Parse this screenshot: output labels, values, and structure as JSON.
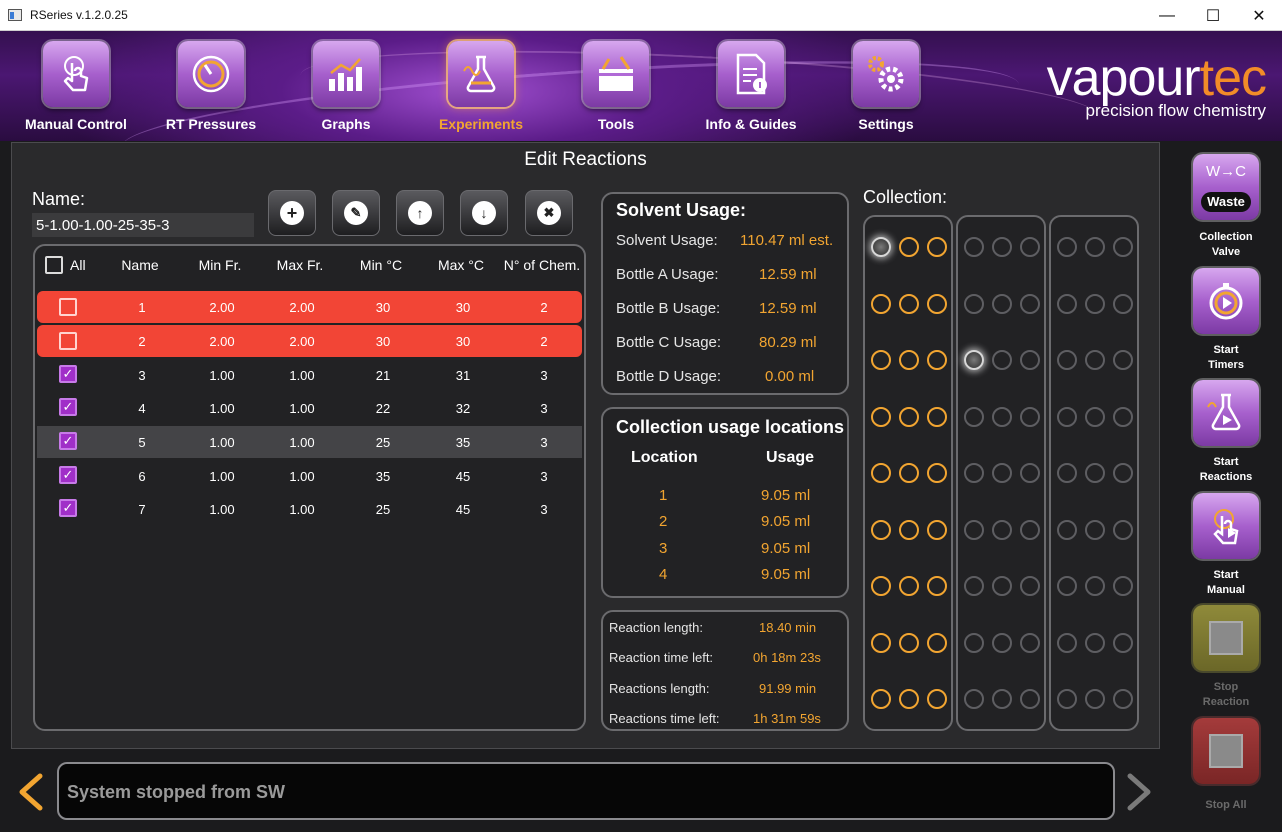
{
  "window": {
    "title": "RSeries v.1.2.0.25",
    "minimize": "—",
    "maximize": "☐",
    "close": "✕"
  },
  "nav": {
    "items": [
      {
        "label": "Manual Control",
        "icon": "hand-touch-icon"
      },
      {
        "label": "RT Pressures",
        "icon": "gauge-icon"
      },
      {
        "label": "Graphs",
        "icon": "bar-chart-icon"
      },
      {
        "label": "Experiments",
        "icon": "flask-icon",
        "active": true
      },
      {
        "label": "Tools",
        "icon": "toolbox-icon"
      },
      {
        "label": "Info & Guides",
        "icon": "document-info-icon"
      },
      {
        "label": "Settings",
        "icon": "gears-icon"
      }
    ]
  },
  "logo": {
    "word_prefix": "vapour",
    "word_suffix": "tec",
    "tagline": "precision flow chemistry"
  },
  "edit": {
    "heading": "Edit Reactions",
    "name_label": "Name:",
    "name_value": "5-1.00-1.00-25-35-3"
  },
  "table": {
    "headers": {
      "all": "All",
      "name": "Name",
      "min_fr": "Min Fr.",
      "max_fr": "Max Fr.",
      "min_c": "Min °C",
      "max_c": "Max °C",
      "chem": "N° of Chem."
    },
    "rows": [
      {
        "name": "1",
        "min_fr": "2.00",
        "max_fr": "2.00",
        "min_c": "30",
        "max_c": "30",
        "chem": "2",
        "checked": false,
        "state": "error"
      },
      {
        "name": "2",
        "min_fr": "2.00",
        "max_fr": "2.00",
        "min_c": "30",
        "max_c": "30",
        "chem": "2",
        "checked": false,
        "state": "error"
      },
      {
        "name": "3",
        "min_fr": "1.00",
        "max_fr": "1.00",
        "min_c": "21",
        "max_c": "31",
        "chem": "3",
        "checked": true,
        "state": "normal"
      },
      {
        "name": "4",
        "min_fr": "1.00",
        "max_fr": "1.00",
        "min_c": "22",
        "max_c": "32",
        "chem": "3",
        "checked": true,
        "state": "normal"
      },
      {
        "name": "5",
        "min_fr": "1.00",
        "max_fr": "1.00",
        "min_c": "25",
        "max_c": "35",
        "chem": "3",
        "checked": true,
        "state": "selected"
      },
      {
        "name": "6",
        "min_fr": "1.00",
        "max_fr": "1.00",
        "min_c": "35",
        "max_c": "45",
        "chem": "3",
        "checked": true,
        "state": "normal"
      },
      {
        "name": "7",
        "min_fr": "1.00",
        "max_fr": "1.00",
        "min_c": "25",
        "max_c": "45",
        "chem": "3",
        "checked": true,
        "state": "normal"
      }
    ]
  },
  "solvent": {
    "title": "Solvent Usage:",
    "rows": [
      {
        "label": "Solvent Usage:",
        "value": "110.47 ml est."
      },
      {
        "label": "Bottle A Usage:",
        "value": "12.59 ml"
      },
      {
        "label": "Bottle B Usage:",
        "value": "12.59 ml"
      },
      {
        "label": "Bottle C Usage:",
        "value": "80.29 ml"
      },
      {
        "label": "Bottle D Usage:",
        "value": "0.00 ml"
      }
    ]
  },
  "collection_usage": {
    "title": "Collection usage locations",
    "col_location": "Location",
    "col_usage": "Usage",
    "rows": [
      {
        "location": "1",
        "usage": "9.05 ml"
      },
      {
        "location": "2",
        "usage": "9.05 ml"
      },
      {
        "location": "3",
        "usage": "9.05 ml"
      },
      {
        "location": "4",
        "usage": "9.05 ml"
      }
    ]
  },
  "timing": {
    "rows": [
      {
        "label": "Reaction length:",
        "value": "18.40 min"
      },
      {
        "label": "Reaction time left:",
        "value": "0h 18m 23s"
      },
      {
        "label": "Reactions length:",
        "value": "91.99 min"
      },
      {
        "label": "Reactions time left:",
        "value": "1h 31m 59s"
      }
    ]
  },
  "collection": {
    "label": "Collection:",
    "racks": [
      {
        "rows": [
          [
            "w",
            "o",
            "o"
          ],
          [
            "o",
            "o",
            "o"
          ],
          [
            "o",
            "o",
            "o"
          ],
          [
            "o",
            "o",
            "o"
          ],
          [
            "o",
            "o",
            "o"
          ],
          [
            "o",
            "o",
            "o"
          ],
          [
            "o",
            "o",
            "o"
          ],
          [
            "o",
            "o",
            "o"
          ],
          [
            "o",
            "o",
            "o"
          ]
        ]
      },
      {
        "rows": [
          [
            "g",
            "g",
            "g"
          ],
          [
            "g",
            "g",
            "g"
          ],
          [
            "w",
            "g",
            "g"
          ],
          [
            "g",
            "g",
            "g"
          ],
          [
            "g",
            "g",
            "g"
          ],
          [
            "g",
            "g",
            "g"
          ],
          [
            "g",
            "g",
            "g"
          ],
          [
            "g",
            "g",
            "g"
          ],
          [
            "g",
            "g",
            "g"
          ]
        ]
      },
      {
        "rows": [
          [
            "g",
            "g",
            "g"
          ],
          [
            "g",
            "g",
            "g"
          ],
          [
            "g",
            "g",
            "g"
          ],
          [
            "g",
            "g",
            "g"
          ],
          [
            "g",
            "g",
            "g"
          ],
          [
            "g",
            "g",
            "g"
          ],
          [
            "g",
            "g",
            "g"
          ],
          [
            "g",
            "g",
            "g"
          ],
          [
            "g",
            "g",
            "g"
          ]
        ]
      }
    ]
  },
  "side": {
    "collection_valve": {
      "top": "W→C",
      "badge": "Waste",
      "label1": "Collection",
      "label2": "Valve"
    },
    "start_timers": {
      "label1": "Start",
      "label2": "Timers"
    },
    "start_reactions": {
      "label1": "Start",
      "label2": "Reactions"
    },
    "start_manual": {
      "label1": "Start",
      "label2": "Manual"
    },
    "stop_reaction": {
      "label1": "Stop",
      "label2": "Reaction"
    },
    "stop_all": {
      "label1": "Stop All"
    }
  },
  "status": {
    "message": "System stopped from SW"
  },
  "colors": {
    "accent": "#f2a531",
    "error_row": "#f24536",
    "brand_purple": "#a760cd",
    "check": "#a02fc8"
  }
}
